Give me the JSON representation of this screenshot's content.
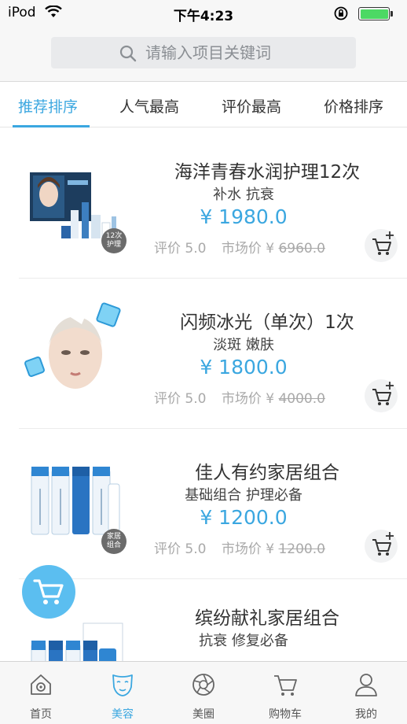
{
  "status_bar": {
    "carrier": "iPod",
    "time": "下午4:23",
    "battery_level": 1.0
  },
  "search": {
    "placeholder": "请输入项目关键词"
  },
  "sort_tabs": [
    {
      "label": "推荐排序",
      "active": true
    },
    {
      "label": "人气最高",
      "active": false
    },
    {
      "label": "评价最高",
      "active": false
    },
    {
      "label": "价格排序",
      "active": false
    }
  ],
  "products": [
    {
      "name": "海洋青春水润护理12次",
      "tags": "补水 抗衰",
      "price": "¥ 1980.0",
      "rating_text": "评价 5.0",
      "market_label": "市场价 ¥ ",
      "market_price": "6960.0",
      "badge": [
        "12次",
        "护理"
      ]
    },
    {
      "name": "闪频冰光（单次）1次",
      "tags": "淡斑 嫩肤",
      "price": "¥ 1800.0",
      "rating_text": "评价 5.0",
      "market_label": "市场价 ¥ ",
      "market_price": "4000.0",
      "badge": []
    },
    {
      "name": "佳人有约家居组合",
      "tags": "基础组合 护理必备",
      "price": "¥ 1200.0",
      "rating_text": "评价 5.0",
      "market_label": "市场价 ¥ ",
      "market_price": "1200.0",
      "badge": [
        "家居",
        "组合"
      ]
    },
    {
      "name": "缤纷献礼家居组合",
      "tags": "抗衰  修复必备",
      "price": "",
      "rating_text": "",
      "market_label": "",
      "market_price": "",
      "badge": []
    }
  ],
  "tab_bar": [
    {
      "label": "首页",
      "icon": "home-icon",
      "active": false
    },
    {
      "label": "美容",
      "icon": "face-mask-icon",
      "active": true
    },
    {
      "label": "美圈",
      "icon": "aperture-icon",
      "active": false
    },
    {
      "label": "购物车",
      "icon": "cart-icon",
      "active": false
    },
    {
      "label": "我的",
      "icon": "profile-icon",
      "active": false
    }
  ],
  "colors": {
    "accent": "#3ba7e0",
    "float_cart": "#5bbef0",
    "battery": "#4cd964"
  }
}
